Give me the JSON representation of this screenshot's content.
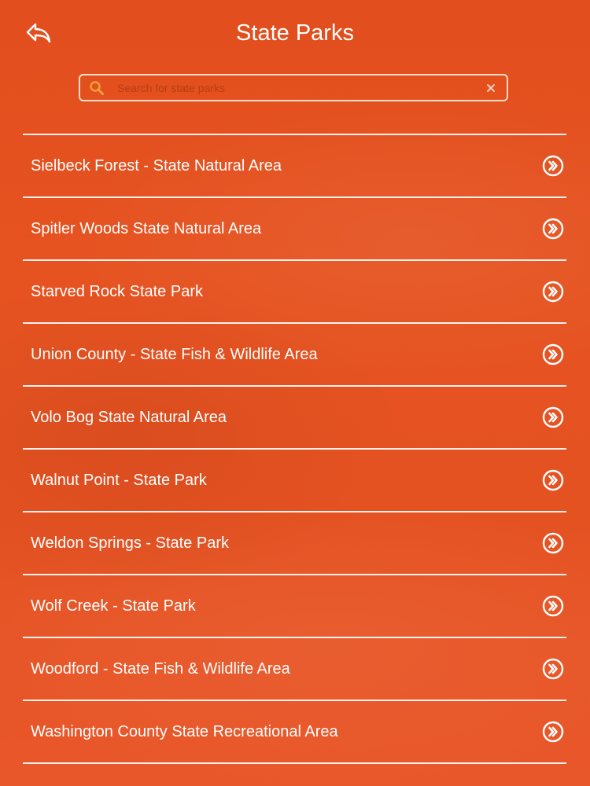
{
  "header": {
    "title": "State Parks",
    "back_icon": "reply-arrow-icon"
  },
  "search": {
    "placeholder": "Search for state parks",
    "value": "",
    "search_icon": "magnifier-icon",
    "clear_icon": "close-x-icon"
  },
  "colors": {
    "background": "#e55222",
    "text": "#ffffff",
    "accent_icon": "#f2a13a",
    "divider": "#ffffff"
  },
  "parks": [
    {
      "name": "Sielbeck Forest - State Natural Area"
    },
    {
      "name": "Spitler Woods State Natural Area"
    },
    {
      "name": "Starved Rock State Park"
    },
    {
      "name": "Union County - State Fish & Wildlife Area"
    },
    {
      "name": "Volo Bog State Natural Area"
    },
    {
      "name": "Walnut Point - State Park"
    },
    {
      "name": "Weldon Springs - State Park"
    },
    {
      "name": "Wolf Creek - State Park"
    },
    {
      "name": "Woodford - State Fish & Wildlife Area"
    },
    {
      "name": "Washington County State Recreational Area"
    }
  ],
  "row_icon": "circle-double-chevron-right-icon"
}
